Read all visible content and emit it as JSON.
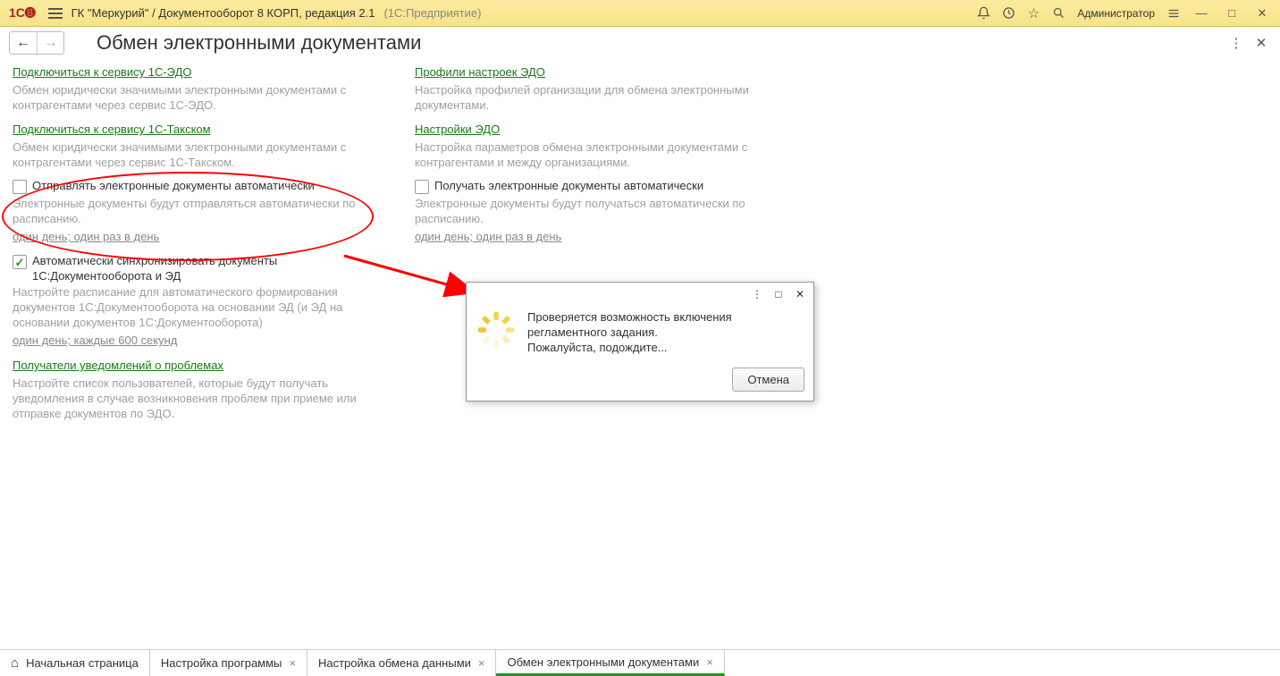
{
  "titlebar": {
    "app_title": "ГК \"Меркурий\" / Документооборот 8 КОРП, редакция 2.1",
    "suffix": "(1С:Предприятие)",
    "user": "Администратор"
  },
  "page": {
    "title": "Обмен электронными документами"
  },
  "left": {
    "connect_edo": {
      "link": "Подключиться к сервису 1С-ЭДО",
      "desc": "Обмен юридически значимыми электронными документами с контрагентами через сервис 1С-ЭДО."
    },
    "connect_taxcom": {
      "link": "Подключиться к сервису 1С-Такском",
      "desc": "Обмен юридически значимыми электронными документами с контрагентами через сервис 1С-Такском."
    },
    "send_auto": {
      "label": "Отправлять электронные документы автоматически",
      "desc": "Электронные документы будут отправляться автоматически по расписанию.",
      "schedule": "один день; один раз в день"
    },
    "sync": {
      "label": "Автоматически синхронизировать документы",
      "sub": "1С:Документооборота и ЭД",
      "desc": "Настройте расписание для автоматического формирования документов 1С:Документооборота на основании ЭД (и ЭД на основании документов 1С:Документооборота)",
      "schedule": "один день; каждые 600 секунд"
    },
    "recipients": {
      "link": "Получатели уведомлений о проблемах",
      "desc": "Настройте список пользователей, которые будут получать уведомления в случае возникновения проблем при приеме или отправке документов по ЭДО."
    }
  },
  "right": {
    "profiles": {
      "link": "Профили настроек ЭДО",
      "desc": "Настройка профилей организации для обмена электронными документами."
    },
    "settings": {
      "link": "Настройки ЭДО",
      "desc": "Настройка параметров обмена электронными документами с контрагентами и между организациями."
    },
    "recv_auto": {
      "label": "Получать электронные документы автоматически",
      "desc": "Электронные документы будут получаться автоматически по расписанию.",
      "schedule": "один день; один раз в день"
    }
  },
  "dialog": {
    "text": "Проверяется возможность включения регламентного задания.\nПожалуйста, подождите...",
    "cancel": "Отмена"
  },
  "tabs": [
    {
      "label": "Начальная страница",
      "home": true,
      "closable": false
    },
    {
      "label": "Настройка программы",
      "closable": true
    },
    {
      "label": "Настройка обмена данными",
      "closable": true
    },
    {
      "label": "Обмен электронными документами",
      "closable": true,
      "active": true
    }
  ]
}
